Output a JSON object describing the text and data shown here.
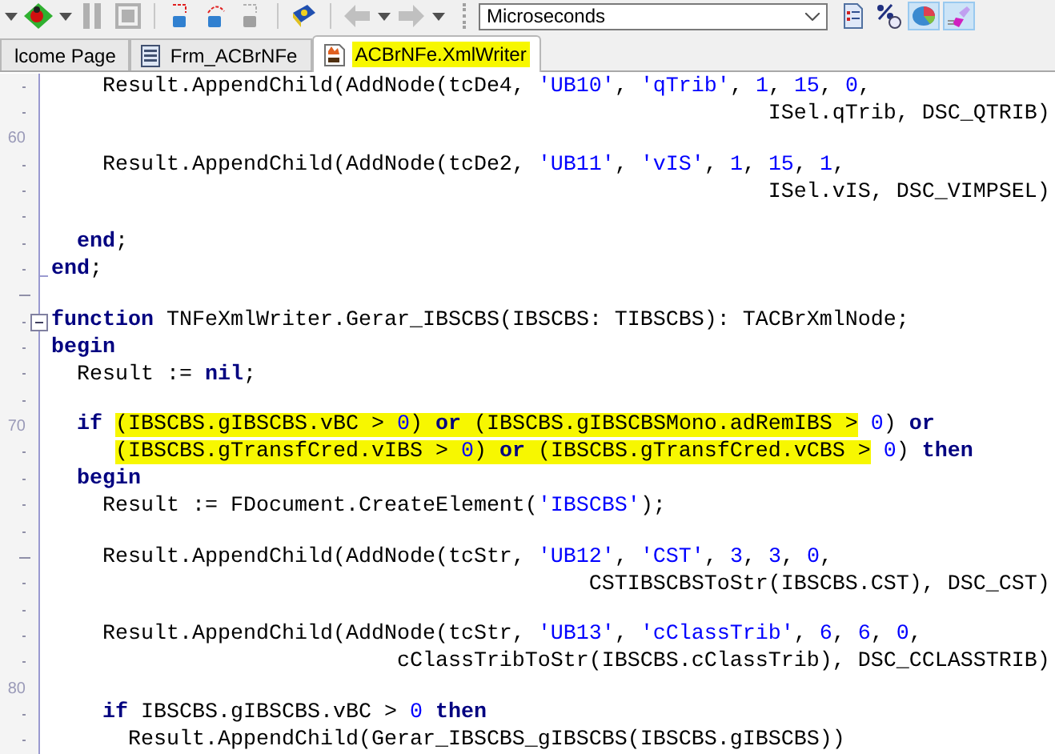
{
  "toolbar": {
    "timing_select": {
      "value": "Microseconds"
    }
  },
  "tabs": [
    {
      "label": "lcome Page",
      "selected": false,
      "marked": false
    },
    {
      "label": "Frm_ACBrNFe",
      "selected": false,
      "marked": false
    },
    {
      "label": "ACBrNFe.XmlWriter",
      "selected": true,
      "marked": true
    }
  ],
  "editor": {
    "lines": [
      {
        "gutter": {
          "kind": "dot"
        },
        "tokens": [
          {
            "kind": "plain",
            "text": "    Result.AppendChild(AddNode(tcDe4, "
          },
          {
            "kind": "str",
            "text": "'UB10'"
          },
          {
            "kind": "plain",
            "text": ", "
          },
          {
            "kind": "str",
            "text": "'qTrib'"
          },
          {
            "kind": "plain",
            "text": ", "
          },
          {
            "kind": "num",
            "text": "1"
          },
          {
            "kind": "plain",
            "text": ", "
          },
          {
            "kind": "num",
            "text": "15"
          },
          {
            "kind": "plain",
            "text": ", "
          },
          {
            "kind": "num",
            "text": "0"
          },
          {
            "kind": "plain",
            "text": ","
          }
        ]
      },
      {
        "gutter": {
          "kind": "dot"
        },
        "tokens": [
          {
            "kind": "plain",
            "text": "                                                        ISel.qTrib, DSC_QTRIB)"
          }
        ]
      },
      {
        "gutter": {
          "kind": "number",
          "label": "60"
        }
      },
      {
        "gutter": {
          "kind": "dot"
        },
        "tokens": [
          {
            "kind": "plain",
            "text": "    Result.AppendChild(AddNode(tcDe2, "
          },
          {
            "kind": "str",
            "text": "'UB11'"
          },
          {
            "kind": "plain",
            "text": ", "
          },
          {
            "kind": "str",
            "text": "'vIS'"
          },
          {
            "kind": "plain",
            "text": ", "
          },
          {
            "kind": "num",
            "text": "1"
          },
          {
            "kind": "plain",
            "text": ", "
          },
          {
            "kind": "num",
            "text": "15"
          },
          {
            "kind": "plain",
            "text": ", "
          },
          {
            "kind": "num",
            "text": "1"
          },
          {
            "kind": "plain",
            "text": ","
          }
        ]
      },
      {
        "gutter": {
          "kind": "dot"
        },
        "tokens": [
          {
            "kind": "plain",
            "text": "                                                        ISel.vIS, DSC_VIMPSEL)"
          }
        ]
      },
      {
        "gutter": {
          "kind": "dot"
        }
      },
      {
        "gutter": {
          "kind": "dot"
        },
        "tokens": [
          {
            "kind": "kw",
            "text": "  end"
          },
          {
            "kind": "plain",
            "text": ";"
          }
        ]
      },
      {
        "gutter": {
          "kind": "dot"
        },
        "tokens": [
          {
            "kind": "kw",
            "text": "end"
          },
          {
            "kind": "plain",
            "text": ";"
          }
        ]
      },
      {
        "gutter": {
          "kind": "dash"
        }
      },
      {
        "gutter": {
          "kind": "dot"
        },
        "tokens": [
          {
            "kind": "kw",
            "text": "function"
          },
          {
            "kind": "plain",
            "text": " TNFeXmlWriter.Gerar_IBSCBS(IBSCBS: TIBSCBS): TACBrXmlNode;"
          }
        ]
      },
      {
        "gutter": {
          "kind": "dot"
        },
        "tokens": [
          {
            "kind": "kw",
            "text": "begin"
          }
        ]
      },
      {
        "gutter": {
          "kind": "dot"
        },
        "tokens": [
          {
            "kind": "plain",
            "text": "  Result := "
          },
          {
            "kind": "kw",
            "text": "nil"
          },
          {
            "kind": "plain",
            "text": ";"
          }
        ]
      },
      {
        "gutter": {
          "kind": "dot"
        }
      },
      {
        "gutter": {
          "kind": "number",
          "label": "70"
        },
        "tokens": [
          {
            "kind": "kw",
            "text": "  if "
          },
          {
            "kind": "mark",
            "tokens": [
              {
                "kind": "plain",
                "text": "(IBSCBS.gIBSCBS.vBC > "
              },
              {
                "kind": "num",
                "text": "0"
              },
              {
                "kind": "plain",
                "text": ") "
              },
              {
                "kind": "kw",
                "text": "or"
              },
              {
                "kind": "plain",
                "text": " (IBSCBS.gIBSCBSMono.adRemIBS >"
              }
            ]
          },
          {
            "kind": "num",
            "text": " 0"
          },
          {
            "kind": "plain",
            "text": ") "
          },
          {
            "kind": "kw",
            "text": "or"
          }
        ]
      },
      {
        "gutter": {
          "kind": "dot"
        },
        "tokens": [
          {
            "kind": "mark",
            "tokens": [
              {
                "kind": "plain",
                "text": "     (IBSCBS.gTransfCred.vIBS > "
              },
              {
                "kind": "num",
                "text": "0"
              },
              {
                "kind": "plain",
                "text": ") "
              },
              {
                "kind": "kw",
                "text": "or"
              },
              {
                "kind": "plain",
                "text": " (IBSCBS.gTransfCred.vCBS >"
              }
            ]
          },
          {
            "kind": "num",
            "text": " 0"
          },
          {
            "kind": "plain",
            "text": ") "
          },
          {
            "kind": "kw",
            "text": "then"
          }
        ]
      },
      {
        "gutter": {
          "kind": "dot"
        },
        "tokens": [
          {
            "kind": "kw",
            "text": "  begin"
          }
        ]
      },
      {
        "gutter": {
          "kind": "dot"
        },
        "tokens": [
          {
            "kind": "plain",
            "text": "    Result := FDocument.CreateElement("
          },
          {
            "kind": "str",
            "text": "'IBSCBS'"
          },
          {
            "kind": "plain",
            "text": ");"
          }
        ]
      },
      {
        "gutter": {
          "kind": "dot"
        }
      },
      {
        "gutter": {
          "kind": "dash"
        },
        "tokens": [
          {
            "kind": "plain",
            "text": "    Result.AppendChild(AddNode(tcStr, "
          },
          {
            "kind": "str",
            "text": "'UB12'"
          },
          {
            "kind": "plain",
            "text": ", "
          },
          {
            "kind": "str",
            "text": "'CST'"
          },
          {
            "kind": "plain",
            "text": ", "
          },
          {
            "kind": "num",
            "text": "3"
          },
          {
            "kind": "plain",
            "text": ", "
          },
          {
            "kind": "num",
            "text": "3"
          },
          {
            "kind": "plain",
            "text": ", "
          },
          {
            "kind": "num",
            "text": "0"
          },
          {
            "kind": "plain",
            "text": ","
          }
        ]
      },
      {
        "gutter": {
          "kind": "dot"
        },
        "tokens": [
          {
            "kind": "plain",
            "text": "                                          CSTIBSCBSToStr(IBSCBS.CST), DSC_CST)"
          }
        ]
      },
      {
        "gutter": {
          "kind": "dot"
        }
      },
      {
        "gutter": {
          "kind": "dot"
        },
        "tokens": [
          {
            "kind": "plain",
            "text": "    Result.AppendChild(AddNode(tcStr, "
          },
          {
            "kind": "str",
            "text": "'UB13'"
          },
          {
            "kind": "plain",
            "text": ", "
          },
          {
            "kind": "str",
            "text": "'cClassTrib'"
          },
          {
            "kind": "plain",
            "text": ", "
          },
          {
            "kind": "num",
            "text": "6"
          },
          {
            "kind": "plain",
            "text": ", "
          },
          {
            "kind": "num",
            "text": "6"
          },
          {
            "kind": "plain",
            "text": ", "
          },
          {
            "kind": "num",
            "text": "0"
          },
          {
            "kind": "plain",
            "text": ","
          }
        ]
      },
      {
        "gutter": {
          "kind": "dot"
        },
        "tokens": [
          {
            "kind": "plain",
            "text": "                           cClassTribToStr(IBSCBS.cClassTrib), DSC_CCLASSTRIB)"
          }
        ]
      },
      {
        "gutter": {
          "kind": "number",
          "label": "80"
        }
      },
      {
        "gutter": {
          "kind": "dot"
        },
        "tokens": [
          {
            "kind": "kw",
            "text": "    if"
          },
          {
            "kind": "plain",
            "text": " IBSCBS.gIBSCBS.vBC > "
          },
          {
            "kind": "num",
            "text": "0"
          },
          {
            "kind": "kw",
            "text": " then"
          }
        ]
      },
      {
        "gutter": {
          "kind": "dot"
        },
        "tokens": [
          {
            "kind": "plain",
            "text": "      Result.AppendChild(Gerar_IBSCBS_gIBSCBS(IBSCBS.gIBSCBS))"
          }
        ]
      }
    ]
  }
}
